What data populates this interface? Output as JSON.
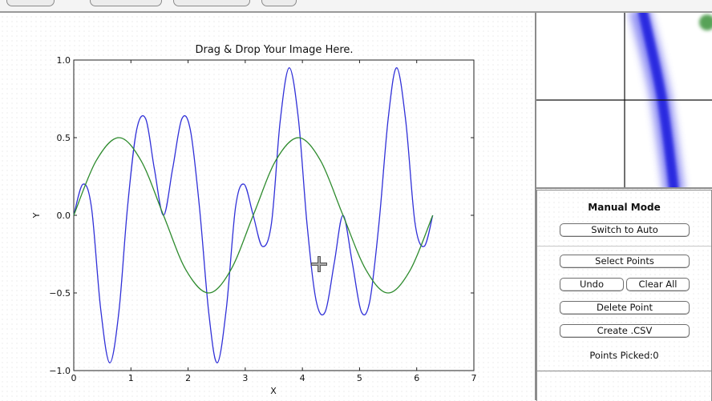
{
  "toolbar": {
    "buttons": [
      "",
      "",
      "",
      ""
    ]
  },
  "plot": {
    "title": "Drag & Drop Your Image Here.",
    "xlabel": "X",
    "ylabel": "Y"
  },
  "chart_data": {
    "type": "line",
    "title": "Drag & Drop Your Image Here.",
    "xlabel": "X",
    "ylabel": "Y",
    "xlim": [
      0,
      7
    ],
    "ylim": [
      -1.0,
      1.0
    ],
    "x_ticks": [
      "0",
      "1",
      "2",
      "3",
      "4",
      "5",
      "6",
      "7"
    ],
    "y_ticks": [
      "1.0",
      "0.5",
      "0.0",
      "−0.5",
      "−1.0"
    ],
    "grid": false,
    "series": [
      {
        "color": "#3030d8",
        "x": [
          0,
          0.16,
          0.31,
          0.47,
          0.63,
          0.79,
          0.94,
          1.1,
          1.26,
          1.41,
          1.57,
          1.73,
          1.89,
          2.04,
          2.2,
          2.36,
          2.51,
          2.67,
          2.83,
          2.98,
          3.14,
          3.3,
          3.46,
          3.61,
          3.77,
          3.93,
          4.08,
          4.24,
          4.4,
          4.56,
          4.71,
          4.87,
          5.03,
          5.18,
          5.34,
          5.5,
          5.65,
          5.81,
          5.97,
          6.13,
          6.28
        ],
        "y": [
          0.0,
          0.2,
          0.05,
          -0.6,
          -0.95,
          -0.62,
          0.05,
          0.55,
          0.62,
          0.3,
          0.0,
          0.3,
          0.62,
          0.55,
          0.05,
          -0.62,
          -0.95,
          -0.6,
          0.05,
          0.2,
          0.0,
          -0.2,
          -0.05,
          0.6,
          0.95,
          0.62,
          -0.05,
          -0.55,
          -0.62,
          -0.3,
          0.0,
          -0.3,
          -0.62,
          -0.55,
          -0.05,
          0.62,
          0.95,
          0.6,
          -0.05,
          -0.2,
          0.0
        ]
      },
      {
        "color": "#2e8b2e",
        "x": [
          0,
          0.39,
          0.79,
          1.18,
          1.57,
          1.96,
          2.36,
          2.75,
          3.14,
          3.53,
          3.93,
          4.32,
          4.71,
          5.11,
          5.5,
          5.89,
          6.28
        ],
        "y": [
          0.0,
          0.35,
          0.5,
          0.35,
          0.0,
          -0.35,
          -0.5,
          -0.35,
          0.0,
          0.35,
          0.5,
          0.35,
          0.0,
          -0.35,
          -0.5,
          -0.35,
          0.0
        ]
      }
    ]
  },
  "panel": {
    "mode_title": "Manual Mode",
    "switch_label": "Switch to Auto",
    "select_label": "Select Points",
    "undo_label": "Undo",
    "clear_label": "Clear All",
    "delete_label": "Delete Point",
    "csv_label": "Create .CSV",
    "points_picked": "Points Picked:0"
  },
  "colors": {
    "blue_series": "#3030d8",
    "green_series": "#2e8b2e",
    "border": "#8c8c8c"
  },
  "icons": {
    "cursor": "move-crosshair-icon"
  }
}
